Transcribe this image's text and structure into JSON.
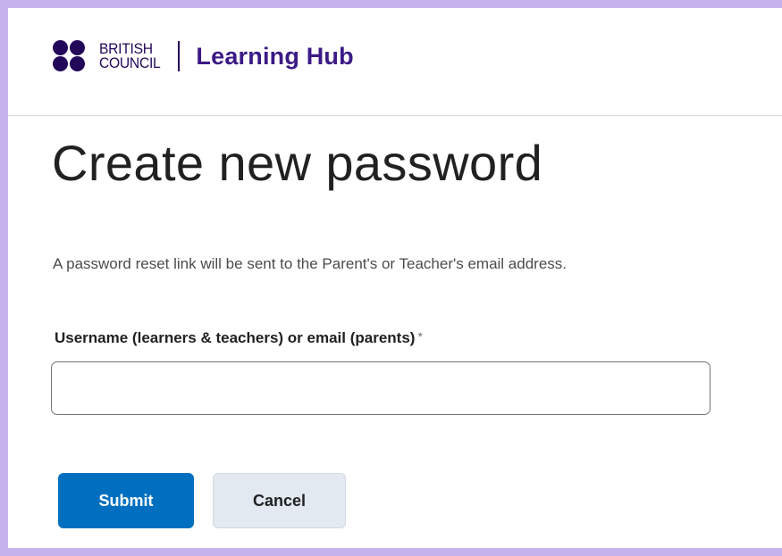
{
  "header": {
    "brand_line1": "BRITISH",
    "brand_line2": "COUNCIL",
    "app_title": "Learning Hub"
  },
  "page": {
    "title": "Create new password",
    "info": "A password reset link will be sent to the Parent's or Teacher's email address."
  },
  "form": {
    "field_label": "Username (learners & teachers) or email (parents)",
    "required_marker": "*",
    "field_value": "",
    "submit_label": "Submit",
    "cancel_label": "Cancel"
  },
  "colors": {
    "brand": "#23085a",
    "primary_button": "#006fbf",
    "secondary_button": "#e3e9f1",
    "frame_border": "#c6b3ee"
  }
}
